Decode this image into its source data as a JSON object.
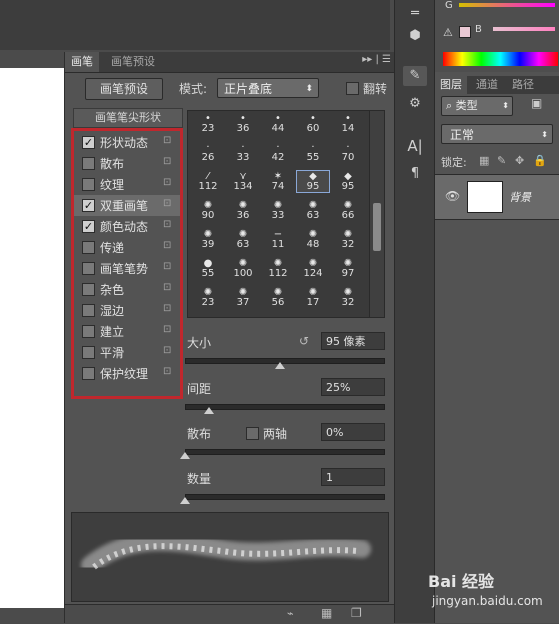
{
  "brush_panel": {
    "tabs": [
      "画笔",
      "画笔预设"
    ],
    "preset_button": "画笔预设",
    "mode_label": "模式:",
    "mode_value": "正片叠底",
    "flip_label": "翻转",
    "tip_header": "画笔笔尖形状",
    "options": [
      {
        "label": "形状动态",
        "checked": true
      },
      {
        "label": "散布",
        "checked": false
      },
      {
        "label": "纹理",
        "checked": false
      },
      {
        "label": "双重画笔",
        "checked": true,
        "selected": true
      },
      {
        "label": "颜色动态",
        "checked": true
      },
      {
        "label": "传递",
        "checked": false
      },
      {
        "label": "画笔笔势",
        "checked": false
      },
      {
        "label": "杂色",
        "checked": false
      },
      {
        "label": "湿边",
        "checked": false
      },
      {
        "label": "建立",
        "checked": false
      },
      {
        "label": "平滑",
        "checked": false
      },
      {
        "label": "保护纹理",
        "checked": false
      }
    ],
    "brush_sizes": [
      "23",
      "36",
      "44",
      "60",
      "14",
      "26",
      "33",
      "42",
      "55",
      "70",
      "112",
      "134",
      "74",
      "95",
      "95",
      "90",
      "36",
      "33",
      "63",
      "66",
      "39",
      "63",
      "11",
      "48",
      "32",
      "55",
      "100",
      "112",
      "124",
      "97",
      "23",
      "37",
      "56",
      "17",
      "32"
    ],
    "selected_brush_index": 13,
    "size": {
      "label": "大小",
      "value": "95 像素",
      "level": 0.48
    },
    "spacing": {
      "label": "间距",
      "value": "25%",
      "level": 0.12
    },
    "scatter": {
      "label": "散布",
      "both_axes_label": "两轴",
      "value": "0%",
      "level": 0.0
    },
    "count": {
      "label": "数量",
      "value": "1",
      "level": 0.0
    }
  },
  "layers_panel": {
    "tabs": [
      "图层",
      "通道",
      "路径"
    ],
    "kind_filter": "类型",
    "blend_mode": "正常",
    "lock_label": "锁定:",
    "layer_name": "背景"
  },
  "color_panel": {
    "g_label": "G",
    "b_label": "B"
  },
  "colors": {
    "highlight_border": "#c0272d",
    "panel_bg": "#535353"
  },
  "watermark": {
    "brand": "Bai 经验",
    "url": "jingyan.baidu.com"
  }
}
